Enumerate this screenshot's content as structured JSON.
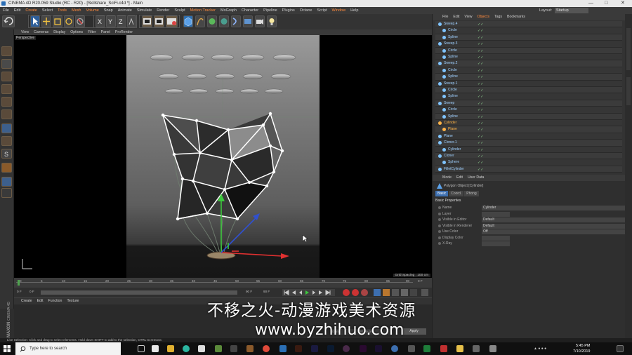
{
  "window": {
    "title": "CINEMA 4D R20.059 Studio (RC - R20) - [Skillshare_SciFi.c4d *] - Main",
    "controls": [
      "—",
      "□",
      "✕"
    ]
  },
  "menubar": {
    "items": [
      "File",
      "Edit",
      "Create",
      "Select",
      "Tools",
      "Mesh",
      "Volume",
      "Snap",
      "Animate",
      "Simulate",
      "Render",
      "Sculpt",
      "Motion Tracker",
      "MoGraph",
      "Character",
      "Pipeline",
      "Plugins",
      "Octane",
      "Script",
      "Window",
      "Help"
    ],
    "layout_label": "Layout:",
    "layout_value": "Startup"
  },
  "viewport": {
    "menu": [
      "View",
      "Cameras",
      "Display",
      "Options",
      "Filter",
      "Panel",
      "ProRender"
    ],
    "label": "Perspective",
    "grid_spacing": "Grid Spacing : 100 cm"
  },
  "timeline": {
    "ticks": [
      "0",
      "5",
      "10",
      "15",
      "20",
      "25",
      "30",
      "35",
      "40",
      "45",
      "50",
      "55",
      "60",
      "65",
      "70",
      "75",
      "80",
      "85",
      "90"
    ],
    "frame_end": "0 F"
  },
  "playback": {
    "start": "0 F",
    "current": "0 F",
    "end": "90 F",
    "end2": "90 F"
  },
  "material_manager": {
    "menu": [
      "Create",
      "Edit",
      "Function",
      "Texture"
    ]
  },
  "coords": {
    "x": "0 cm",
    "y": "20.99 cm",
    "apply": "Apply"
  },
  "object_manager": {
    "menu": [
      "File",
      "Edit",
      "View",
      "Objects",
      "Tags",
      "Bookmarks"
    ],
    "rows": [
      {
        "name": "Sweep.4",
        "indent": 0,
        "color": "#7fc4ff"
      },
      {
        "name": "Circle",
        "indent": 1,
        "color": "#7fc4ff"
      },
      {
        "name": "Spline",
        "indent": 1,
        "color": "#7fc4ff"
      },
      {
        "name": "Sweep.3",
        "indent": 0,
        "color": "#7fc4ff"
      },
      {
        "name": "Circle",
        "indent": 1,
        "color": "#7fc4ff"
      },
      {
        "name": "Spline",
        "indent": 1,
        "color": "#7fc4ff"
      },
      {
        "name": "Sweep.2",
        "indent": 0,
        "color": "#7fc4ff"
      },
      {
        "name": "Circle",
        "indent": 1,
        "color": "#7fc4ff"
      },
      {
        "name": "Spline",
        "indent": 1,
        "color": "#7fc4ff"
      },
      {
        "name": "Sweep.1",
        "indent": 0,
        "color": "#7fc4ff"
      },
      {
        "name": "Circle",
        "indent": 1,
        "color": "#7fc4ff"
      },
      {
        "name": "Spline",
        "indent": 1,
        "color": "#7fc4ff"
      },
      {
        "name": "Sweep",
        "indent": 0,
        "color": "#7fc4ff"
      },
      {
        "name": "Circle",
        "indent": 1,
        "color": "#7fc4ff"
      },
      {
        "name": "Spline",
        "indent": 1,
        "color": "#7fc4ff"
      },
      {
        "name": "Cylinder",
        "indent": 0,
        "color": "#ffb347"
      },
      {
        "name": "Plane",
        "indent": 1,
        "color": "#ffb347"
      },
      {
        "name": "Plane",
        "indent": 0,
        "color": "#7fc4ff"
      },
      {
        "name": "Cloner.1",
        "indent": 0,
        "color": "#7fc4ff"
      },
      {
        "name": "Cylinder",
        "indent": 1,
        "color": "#7fc4ff"
      },
      {
        "name": "Cloner",
        "indent": 0,
        "color": "#7fc4ff"
      },
      {
        "name": "Sphere",
        "indent": 1,
        "color": "#7fc4ff"
      },
      {
        "name": "FilletCylinder",
        "indent": 0,
        "color": "#7fc4ff"
      }
    ]
  },
  "attribute_manager": {
    "menu": [
      "Mode",
      "Edit",
      "User Data"
    ],
    "object_title": "Polygon Object [Cylinder]",
    "tabs": [
      "Basic",
      "Coord.",
      "Phong"
    ],
    "section": "Basic Properties",
    "props": [
      {
        "label": "Name",
        "value": "Cylinder"
      },
      {
        "label": "Layer",
        "value": ""
      },
      {
        "label": "Visible in Editor",
        "value": "Default"
      },
      {
        "label": "Visible in Renderer",
        "value": "Default"
      },
      {
        "label": "Use Color",
        "value": "Off"
      },
      {
        "label": "Display Color",
        "value": ""
      },
      {
        "label": "X-Ray",
        "value": ""
      }
    ]
  },
  "statusbar": {
    "text": "Live Selection: Click and drag to select elements. Hold down SHIFT to add to the selection, CTRL to remove."
  },
  "taskbar": {
    "search_placeholder": "Type here to search",
    "time": "5:45 PM",
    "date": "7/10/2019"
  },
  "watermark": {
    "line1": "不移之火-动漫游戏美术资源",
    "line2": "www.byzhihuo.com"
  },
  "logo": {
    "brand": "MAXON",
    "product": "CINEMA 4D"
  }
}
